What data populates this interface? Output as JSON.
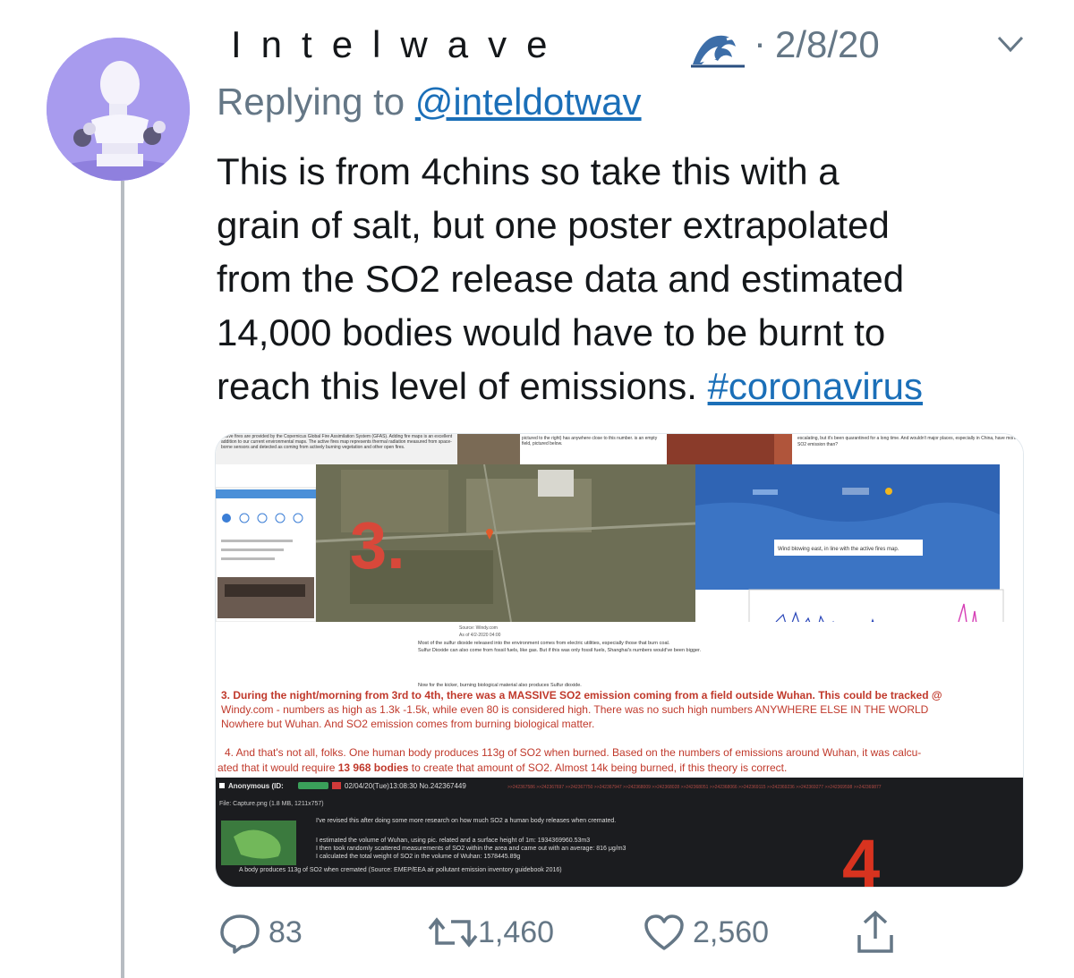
{
  "tweet": {
    "display_name": "Intelwave",
    "separator": "·",
    "date": "2/8/20",
    "reply_prefix": "Replying to",
    "reply_handle": "@inteldotwav",
    "text_before_tag": "This is from 4chins so take this with a\ngrain of salt, but one poster extrapolated\nfrom the SO2 release data and estimated\n14,000 bodies would have to be burnt to\nreach this level of emissions. ",
    "hashtag": "#coronavirus"
  },
  "media": {
    "top_text_1": "Active fires are provided by the Copernicus Global Fire Assimilation System (GFAS). Adding fire maps is an excellent addition to our current environmental maps. The active fires map represents thermal radiation measured from space-borne sensors and detected as coming from actively burning vegetation and other open fires.",
    "top_text_2": "pictured to the right) has anywhere close to this number. is an empty field, pictured below.",
    "top_text_3": "escalating, but it's been quarantined for a long time. And wouldn't major places, especially in China, have more SO2 emission than?",
    "map_label": "3.",
    "source": "Source: Windy.com",
    "source_date": "As of 4/2-2020 04:00",
    "wind_note": "Wind blowing east, in line with the active fires map.",
    "sulfur_1": "Most of the sulfur dioxide released into the environment comes from electric utilities, especially those that burn coal.",
    "sulfur_2": "Sulfur Dioxide can also come from fossil fuels, like gas. But if this was only fossil fuels, Shanghai's numbers would've been bigger.",
    "sulfur_3": "Now for the kicker, burning biological material also produces Sulfur dioxide.",
    "point3_lines": [
      "3. During the night/morning from 3rd to 4th, there was a MASSIVE SO2 emission coming from a field outside Wuhan. This could be tracked @",
      "Windy.com - numbers as high as 1.3k -1.5k, while even 80 is considered high. There was no such high numbers ANYWHERE ELSE IN THE WORLD",
      "Nowhere but Wuhan. And SO2 emission comes from burning biological matter."
    ],
    "point4_line1": "4. And that's not all, folks. One human body produces 113g of SO2 when burned. Based on the numbers of emissions around Wuhan, it was calcu-",
    "point4_line2_a": "ated that it would require ",
    "point4_line2_bold": "13 968 bodies",
    "point4_line2_b": " to create that amount of SO2. Almost 14k being burned, if this theory is correct.",
    "post_author": "Anonymous (ID:",
    "post_meta": "02/04/20(Tue)13:08:30 No.242367449",
    "post_refs": ">>242367586 >>242367697 >>242367750 >>242367947 >>242368009 >>242368028 >>242368051 >>242368066 >>242369115 >>242369236 >>242369277 >>242369598 >>242369877",
    "post_file": "File: Capture.png (1.8 MB, 1211x757)",
    "post_body": [
      "I've revised this after doing some more research on how much SO2 a human body releases when cremated.",
      "I estimated the volume of Wuhan, using pic. related and a surface height of 1m: 1934369960.53m3",
      "I then took randomly scattered measurements of SO2 within the area and came out with an average: 816 μg/m3",
      "I calculated the total weight of SO2 in the volume of Wuhan: 1578445.89g",
      "A body produces 113g of SO2 when cremated (Source: EMEP/EEA air pollutant emission inventory guidebook 2016)"
    ],
    "big_number": "4"
  },
  "actions": {
    "replies": "83",
    "retweets": "1,460",
    "likes": "2,560"
  },
  "colors": {
    "link": "#1b6fb8",
    "muted": "#657786",
    "red_text": "#c0392b",
    "chan_bg": "#1b1c1f"
  },
  "icons": [
    "wave-emoji-icon",
    "chevron-down-icon",
    "reply-icon",
    "retweet-icon",
    "like-icon",
    "share-icon"
  ]
}
